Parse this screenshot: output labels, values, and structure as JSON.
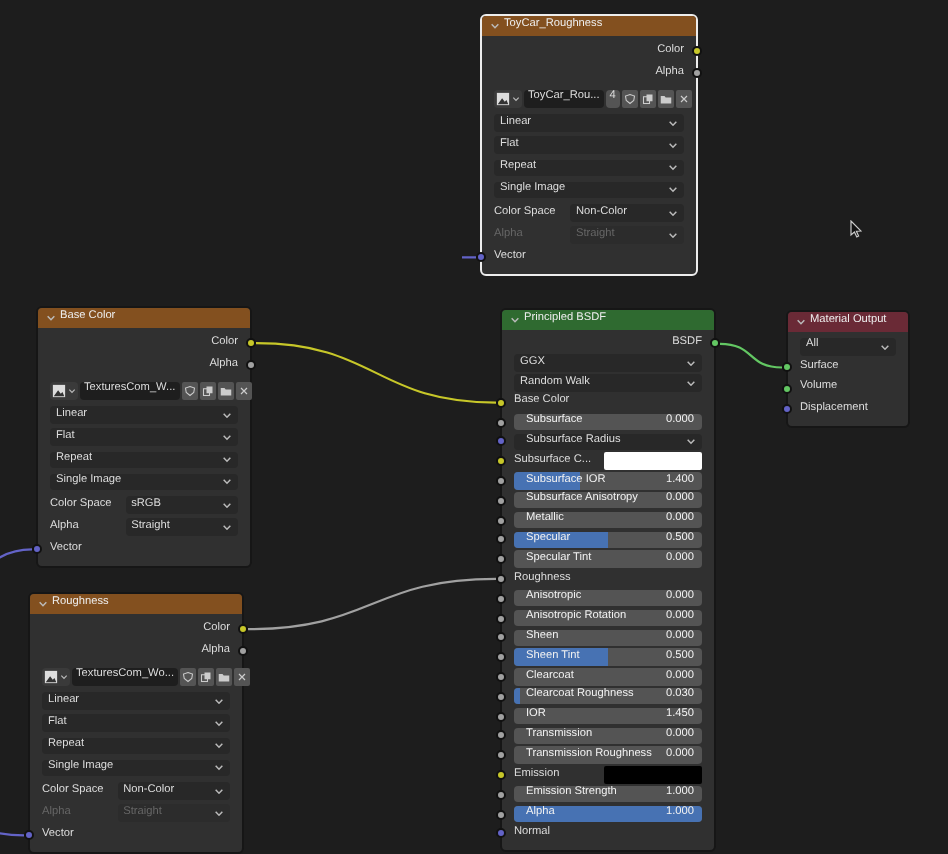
{
  "nodes": [
    {
      "title": "ToyCar_Roughness",
      "kind": "texture",
      "selected": true,
      "rows": [
        {
          "kind": "output",
          "label": "Color",
          "socket": {
            "kind": "color"
          }
        },
        {
          "kind": "output",
          "label": "Alpha",
          "socket": {
            "kind": "float"
          }
        },
        {
          "kind": "image",
          "name": "ToyCar_Rou...",
          "users": "4"
        },
        {
          "kind": "dropdown",
          "value": "Linear"
        },
        {
          "kind": "dropdown",
          "value": "Flat"
        },
        {
          "kind": "dropdown",
          "value": "Repeat"
        },
        {
          "kind": "dropdown",
          "value": "Single Image"
        },
        {
          "kind": "prop",
          "label": "Color Space",
          "value": "Non-Color",
          "disabled": false
        },
        {
          "kind": "prop",
          "label": "Alpha",
          "value": "Straight",
          "disabled": true
        },
        {
          "kind": "input",
          "label": "Vector",
          "socket": {
            "kind": "vector"
          }
        }
      ]
    },
    {
      "title": "Base Color",
      "kind": "texture",
      "selected": false,
      "rows": [
        {
          "kind": "output",
          "label": "Color",
          "socket": {
            "kind": "color"
          }
        },
        {
          "kind": "output",
          "label": "Alpha",
          "socket": {
            "kind": "float"
          }
        },
        {
          "kind": "image",
          "name": "TexturesCom_W..."
        },
        {
          "kind": "dropdown",
          "value": "Linear"
        },
        {
          "kind": "dropdown",
          "value": "Flat"
        },
        {
          "kind": "dropdown",
          "value": "Repeat"
        },
        {
          "kind": "dropdown",
          "value": "Single Image"
        },
        {
          "kind": "prop",
          "label": "Color Space",
          "value": "sRGB",
          "disabled": false
        },
        {
          "kind": "prop",
          "label": "Alpha",
          "value": "Straight",
          "disabled": false
        },
        {
          "kind": "input",
          "label": "Vector",
          "socket": {
            "kind": "vector"
          }
        }
      ]
    },
    {
      "title": "Roughness",
      "kind": "texture",
      "selected": false,
      "rows": [
        {
          "kind": "output",
          "label": "Color",
          "socket": {
            "kind": "color"
          }
        },
        {
          "kind": "output",
          "label": "Alpha",
          "socket": {
            "kind": "float"
          }
        },
        {
          "kind": "image",
          "name": "TexturesCom_Wo..."
        },
        {
          "kind": "dropdown",
          "value": "Linear"
        },
        {
          "kind": "dropdown",
          "value": "Flat"
        },
        {
          "kind": "dropdown",
          "value": "Repeat"
        },
        {
          "kind": "dropdown",
          "value": "Single Image"
        },
        {
          "kind": "prop",
          "label": "Color Space",
          "value": "Non-Color",
          "disabled": false
        },
        {
          "kind": "prop",
          "label": "Alpha",
          "value": "Straight",
          "disabled": true
        },
        {
          "kind": "input",
          "label": "Vector",
          "socket": {
            "kind": "vector"
          }
        }
      ]
    },
    {
      "title": "Principled BSDF",
      "kind": "shader",
      "selected": false,
      "rows": [
        {
          "kind": "output",
          "label": "BSDF",
          "socket": {
            "kind": "shader"
          }
        },
        {
          "kind": "dropdown",
          "value": "GGX"
        },
        {
          "kind": "dropdown",
          "value": "Random Walk"
        },
        {
          "kind": "input",
          "label": "Base Color",
          "socket": {
            "kind": "color"
          }
        },
        {
          "kind": "number",
          "label": "Subsurface",
          "value": "0.000",
          "socket": {
            "kind": "float"
          }
        },
        {
          "kind": "vector_dropdown",
          "label": "Subsurface Radius",
          "socket": {
            "kind": "vector"
          }
        },
        {
          "kind": "color",
          "label": "Subsurface C...",
          "color": "#ffffff",
          "socket": {
            "kind": "color"
          }
        },
        {
          "kind": "slider",
          "label": "Subsurface IOR",
          "value": "1.400",
          "level": 0.35,
          "socket": {
            "kind": "float"
          }
        },
        {
          "kind": "number",
          "label": "Subsurface Anisotropy",
          "value": "0.000",
          "socket": {
            "kind": "float"
          }
        },
        {
          "kind": "number",
          "label": "Metallic",
          "value": "0.000",
          "socket": {
            "kind": "float"
          }
        },
        {
          "kind": "slider",
          "label": "Specular",
          "value": "0.500",
          "level": 0.5,
          "socket": {
            "kind": "float"
          }
        },
        {
          "kind": "number",
          "label": "Specular Tint",
          "value": "0.000",
          "socket": {
            "kind": "float"
          }
        },
        {
          "kind": "input",
          "label": "Roughness",
          "socket": {
            "kind": "float"
          }
        },
        {
          "kind": "number",
          "label": "Anisotropic",
          "value": "0.000",
          "socket": {
            "kind": "float"
          }
        },
        {
          "kind": "number",
          "label": "Anisotropic Rotation",
          "value": "0.000",
          "socket": {
            "kind": "float"
          }
        },
        {
          "kind": "number",
          "label": "Sheen",
          "value": "0.000",
          "socket": {
            "kind": "float"
          }
        },
        {
          "kind": "slider",
          "label": "Sheen Tint",
          "value": "0.500",
          "level": 0.5,
          "socket": {
            "kind": "float"
          }
        },
        {
          "kind": "number",
          "label": "Clearcoat",
          "value": "0.000",
          "socket": {
            "kind": "float"
          }
        },
        {
          "kind": "slider",
          "label": "Clearcoat Roughness",
          "value": "0.030",
          "level": 0.03,
          "socket": {
            "kind": "float"
          }
        },
        {
          "kind": "number",
          "label": "IOR",
          "value": "1.450",
          "socket": {
            "kind": "float"
          }
        },
        {
          "kind": "number",
          "label": "Transmission",
          "value": "0.000",
          "socket": {
            "kind": "float"
          }
        },
        {
          "kind": "number",
          "label": "Transmission Roughness",
          "value": "0.000",
          "socket": {
            "kind": "float"
          }
        },
        {
          "kind": "color",
          "label": "Emission",
          "color": "#000000",
          "socket": {
            "kind": "color"
          }
        },
        {
          "kind": "number",
          "label": "Emission Strength",
          "value": "1.000",
          "socket": {
            "kind": "float"
          }
        },
        {
          "kind": "slider",
          "label": "Alpha",
          "value": "1.000",
          "level": 1,
          "socket": {
            "kind": "float"
          }
        },
        {
          "kind": "input",
          "label": "Normal",
          "socket": {
            "kind": "vector"
          }
        }
      ]
    },
    {
      "title": "Material Output",
      "kind": "output",
      "selected": false,
      "rows": [
        {
          "kind": "dropdown",
          "value": "All"
        },
        {
          "kind": "input",
          "label": "Surface",
          "socket": {
            "kind": "shader"
          }
        },
        {
          "kind": "input",
          "label": "Volume",
          "socket": {
            "kind": "shader"
          }
        },
        {
          "kind": "input",
          "label": "Displacement",
          "socket": {
            "kind": "vector"
          }
        }
      ]
    }
  ]
}
